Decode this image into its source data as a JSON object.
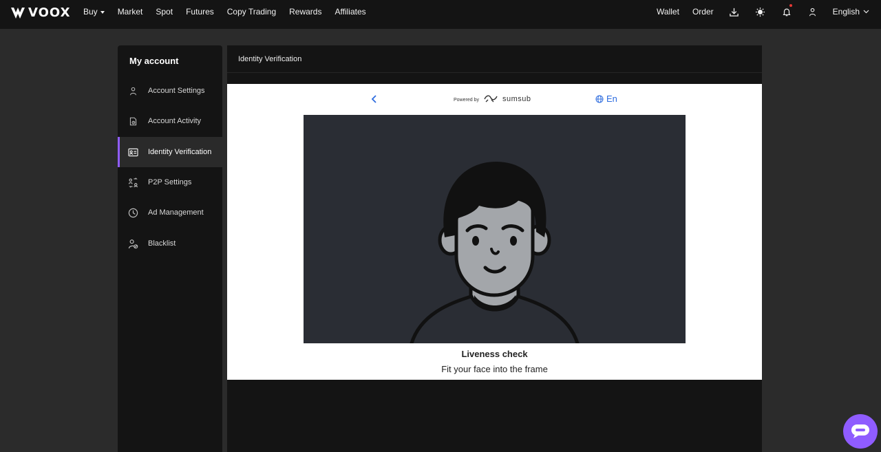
{
  "brand": {
    "name": "VOOX"
  },
  "nav": {
    "items": [
      {
        "label": "Buy",
        "dropdown": true
      },
      {
        "label": "Market"
      },
      {
        "label": "Spot"
      },
      {
        "label": "Futures"
      },
      {
        "label": "Copy Trading"
      },
      {
        "label": "Rewards"
      },
      {
        "label": "Affiliates"
      }
    ],
    "right": {
      "wallet": "Wallet",
      "order": "Order",
      "language": "English",
      "icons": [
        "download-icon",
        "theme-sun-icon",
        "bell-icon",
        "user-icon"
      ]
    }
  },
  "sidebar": {
    "title": "My account",
    "items": [
      {
        "label": "Account Settings",
        "icon": "user-icon"
      },
      {
        "label": "Account Activity",
        "icon": "document-icon"
      },
      {
        "label": "Identity Verification",
        "icon": "id-card-icon",
        "active": true
      },
      {
        "label": "P2P Settings",
        "icon": "p2p-icon"
      },
      {
        "label": "Ad Management",
        "icon": "clock-icon"
      },
      {
        "label": "Blacklist",
        "icon": "user-block-icon"
      }
    ]
  },
  "main": {
    "title": "Identity Verification",
    "widget": {
      "powered_by": "Powered by",
      "provider": "sumsub",
      "language": "En",
      "liveness_title": "Liveness check",
      "liveness_subtitle": "Fit your face into the frame"
    }
  },
  "colors": {
    "accent": "#8f5cff",
    "link_blue": "#2d6cdf",
    "topbar_bg": "#141414",
    "page_bg": "#2b2b2b"
  }
}
